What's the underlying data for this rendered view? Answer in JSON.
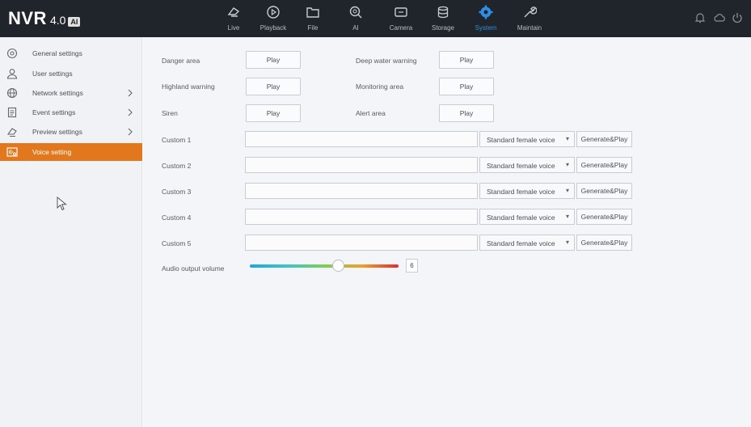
{
  "header": {
    "brand": "NVR",
    "version": "4.0",
    "badge": "AI",
    "nav": [
      {
        "label": "Live",
        "icon": "live-icon"
      },
      {
        "label": "Playback",
        "icon": "playback-icon"
      },
      {
        "label": "File",
        "icon": "folder-icon"
      },
      {
        "label": "AI",
        "icon": "ai-icon"
      },
      {
        "label": "Camera",
        "icon": "camera-icon"
      },
      {
        "label": "Storage",
        "icon": "storage-icon"
      },
      {
        "label": "System",
        "icon": "gear-icon",
        "active": true
      },
      {
        "label": "Maintain",
        "icon": "wrench-icon"
      }
    ],
    "right_icons": [
      "alarm-bell-icon",
      "cloud-icon",
      "power-icon"
    ]
  },
  "sidebar": {
    "items": [
      {
        "label": "General settings",
        "icon": "general-settings-icon",
        "has_children": false
      },
      {
        "label": "User settings",
        "icon": "user-icon",
        "has_children": false
      },
      {
        "label": "Network settings",
        "icon": "globe-icon",
        "has_children": true
      },
      {
        "label": "Event settings",
        "icon": "clipboard-icon",
        "has_children": true
      },
      {
        "label": "Preview settings",
        "icon": "preview-icon",
        "has_children": true
      },
      {
        "label": "Voice setting",
        "icon": "voice-icon",
        "has_children": false,
        "active": true
      }
    ]
  },
  "voice": {
    "presets": [
      {
        "label": "Danger area",
        "button": "Play"
      },
      {
        "label": "Deep water warning",
        "button": "Play"
      },
      {
        "label": "Highland warning",
        "button": "Play"
      },
      {
        "label": "Monitoring area",
        "button": "Play"
      },
      {
        "label": "Siren",
        "button": "Play"
      },
      {
        "label": "Alert area",
        "button": "Play"
      }
    ],
    "custom": [
      {
        "label": "Custom 1",
        "value": "",
        "voice": "Standard female voice",
        "button": "Generate&Play"
      },
      {
        "label": "Custom 2",
        "value": "",
        "voice": "Standard female voice",
        "button": "Generate&Play"
      },
      {
        "label": "Custom 3",
        "value": "",
        "voice": "Standard female voice",
        "button": "Generate&Play"
      },
      {
        "label": "Custom 4",
        "value": "",
        "voice": "Standard female voice",
        "button": "Generate&Play"
      },
      {
        "label": "Custom 5",
        "value": "",
        "voice": "Standard female voice",
        "button": "Generate&Play"
      }
    ],
    "volume_label": "Audio output volume",
    "volume_value": "6",
    "volume_fraction": 0.56
  },
  "colors": {
    "accent_active": "#e2781e",
    "nav_active": "#2f8de4",
    "header_bg": "#20242b"
  }
}
